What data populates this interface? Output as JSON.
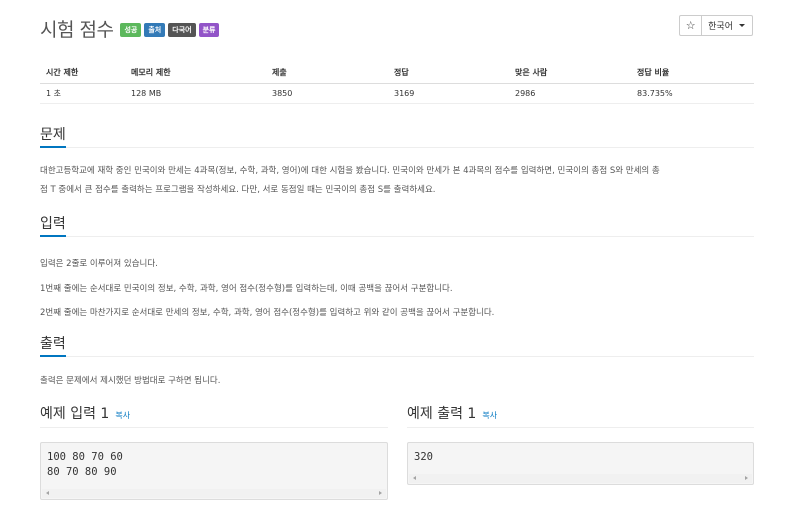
{
  "problem": {
    "title": "시험 점수",
    "badges": [
      {
        "label": "성공",
        "color": "#5cb85c"
      },
      {
        "label": "출처",
        "color": "#337ab7"
      },
      {
        "label": "다국어",
        "color": "#555555"
      },
      {
        "label": "분류",
        "color": "#9254c8"
      }
    ]
  },
  "controls": {
    "star_icon": "☆",
    "language_label": "한국어"
  },
  "info_table": {
    "headers": [
      "시간 제한",
      "메모리 제한",
      "제출",
      "정답",
      "맞은 사람",
      "정답 비율"
    ],
    "row": [
      "1 초",
      "128 MB",
      "3850",
      "3169",
      "2986",
      "83.735%"
    ]
  },
  "sections": {
    "description": {
      "heading": "문제",
      "lines": [
        "대한고등학교에 재학 중인 민국이와 만세는 4과목(정보, 수학, 과학, 영어)에 대한 시험을 봤습니다. 민국이와 만세가 본 4과목의 점수를 입력하면, 민국이의 총점 S와 만세의 총",
        "점 T 중에서 큰 점수를 출력하는 프로그램을 작성하세요. 다만, 서로 동점일 때는 민국이의 총점 S를 출력하세요."
      ]
    },
    "input": {
      "heading": "입력",
      "lines": [
        "입력은 2줄로 이루어져 있습니다.",
        "1번째 줄에는 순서대로 민국이의 정보, 수학, 과학, 영어 점수(정수형)를 입력하는데, 이때 공백을 끊어서 구분합니다.",
        "2번째 줄에는 마찬가지로 순서대로 만세의 정보, 수학, 과학, 영어 점수(정수형)를 입력하고 위와 같이 공백을 끊어서 구분합니다."
      ]
    },
    "output": {
      "heading": "출력",
      "lines": [
        "출력은 문제에서 제시했던 방법대로 구하면 됩니다."
      ]
    }
  },
  "samples": {
    "input": {
      "heading": "예제 입력 1",
      "copy_label": "복사",
      "lines": [
        "100 80 70 60",
        "80 70 80 90"
      ]
    },
    "output": {
      "heading": "예제 출력 1",
      "copy_label": "복사",
      "lines": [
        "320"
      ]
    }
  }
}
